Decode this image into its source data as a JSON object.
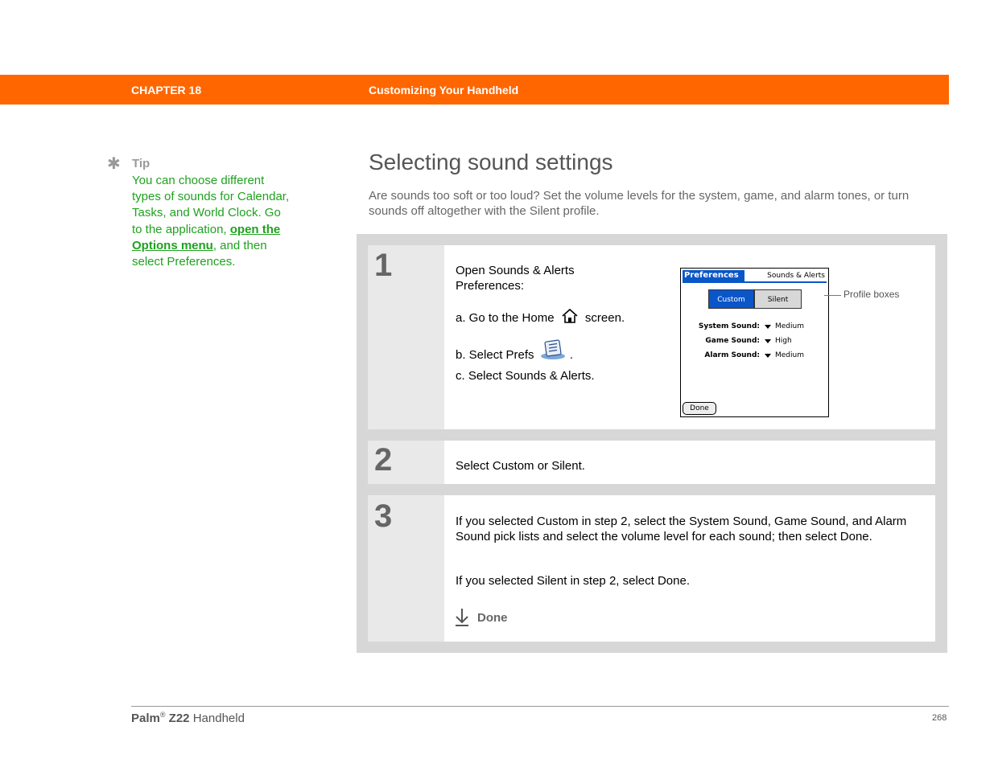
{
  "header": {
    "chapter_label": "CHAPTER 18",
    "chapter_title": "Customizing Your Handheld"
  },
  "tip": {
    "label": "Tip",
    "text_before": "You can choose different types of sounds for Calendar, Tasks, and World Clock. Go to the application, ",
    "link_text": "open the Options menu",
    "text_after": ", and then select Preferences."
  },
  "main": {
    "title": "Selecting sound settings",
    "intro": "Are sounds too soft or too loud? Set the volume levels for the system, game, and alarm tones, or turn sounds off altogether with the Silent profile."
  },
  "steps": [
    {
      "number": "1",
      "lead": "Open Sounds & Alerts Preferences:",
      "sub_a_before": "a.  Go to the Home",
      "sub_a_after": "screen.",
      "sub_b_before": "b.  Select Prefs",
      "sub_b_after": ".",
      "sub_c": "c.  Select Sounds & Alerts."
    },
    {
      "number": "2",
      "text": "Select Custom or Silent."
    },
    {
      "number": "3",
      "text1": "If you selected Custom in step 2, select the System Sound, Game Sound, and Alarm Sound pick lists and select the volume level for each sound; then select Done.",
      "text2": "If you selected Silent in step 2, select Done.",
      "done_label": "Done"
    }
  ],
  "palm_screen": {
    "title": "Preferences",
    "category": "Sounds & Alerts",
    "profile_custom": "Custom",
    "profile_silent": "Silent",
    "rows": [
      {
        "label": "System Sound:",
        "value": "Medium"
      },
      {
        "label": "Game Sound:",
        "value": "High"
      },
      {
        "label": "Alarm Sound:",
        "value": "Medium"
      }
    ],
    "done_button": "Done",
    "accent_color": "#0a56c9"
  },
  "callout": "Profile boxes",
  "footer": {
    "brand": "Palm",
    "registered": "®",
    "model": "Z22",
    "product": "Handheld",
    "page_number": "268"
  },
  "colors": {
    "header_orange": "#ff6600",
    "tip_green": "#1fa21f"
  }
}
